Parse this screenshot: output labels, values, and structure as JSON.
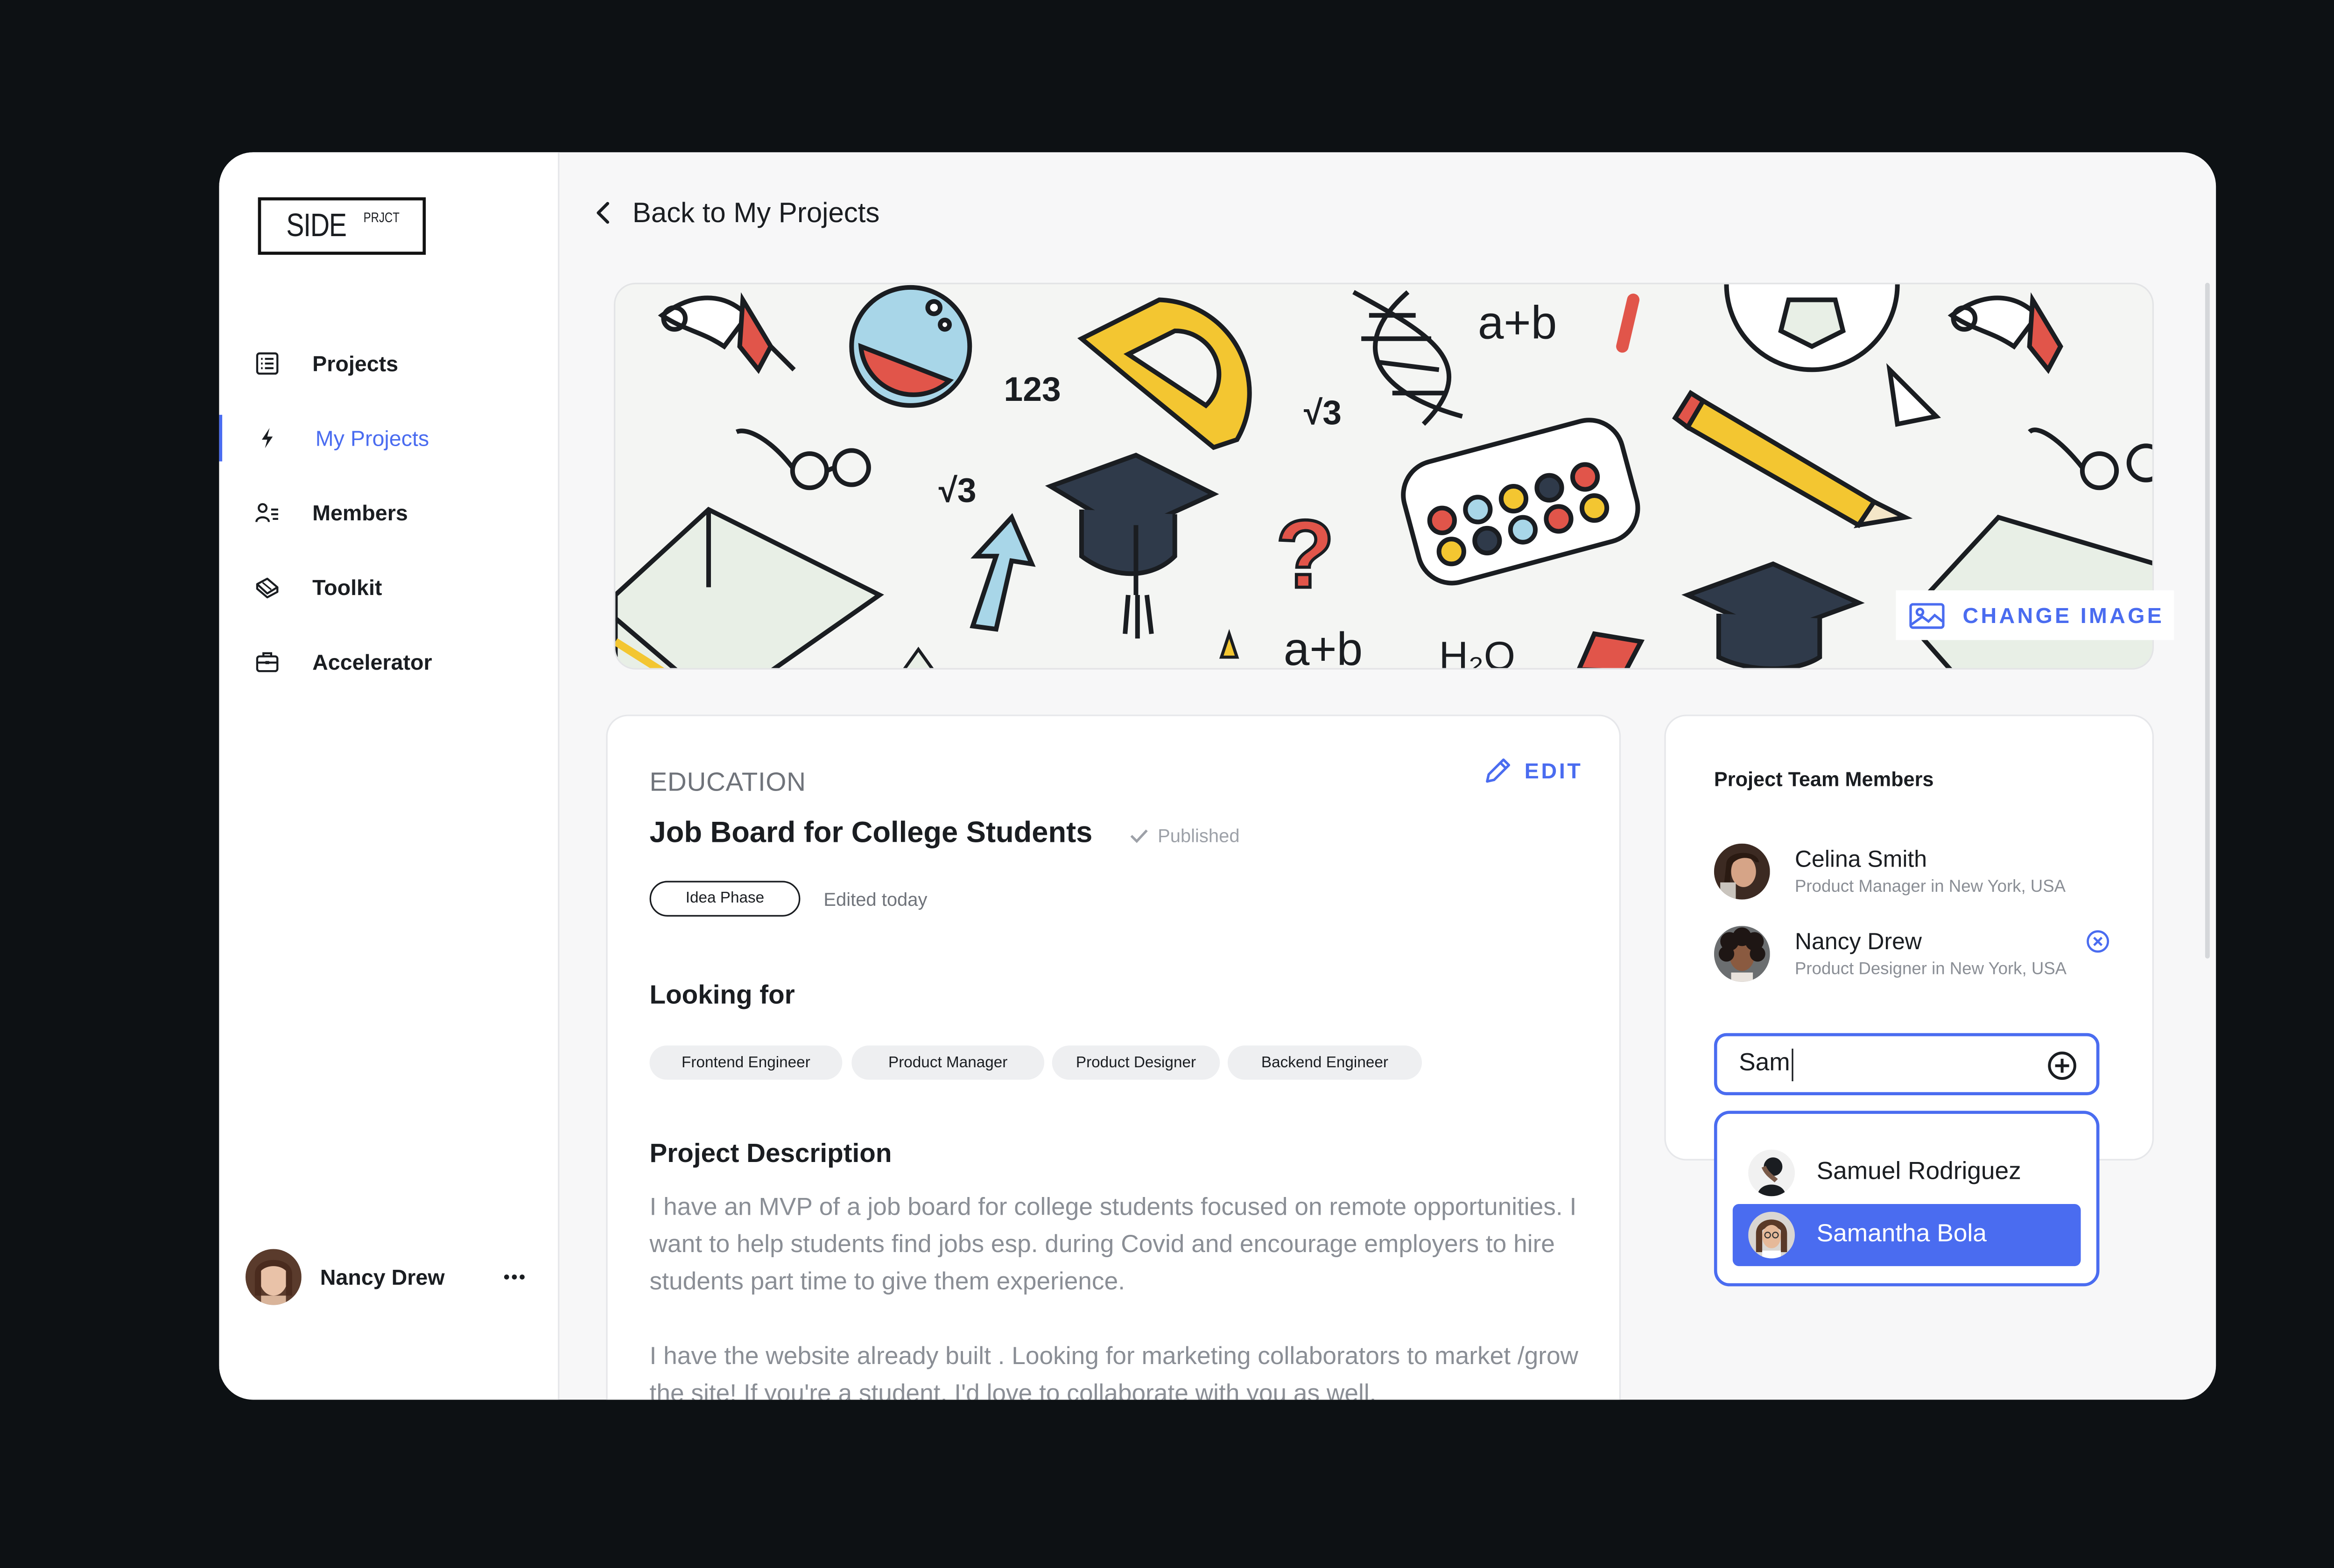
{
  "app": {
    "logo_main": "SIDE",
    "logo_sub": "PRJCT"
  },
  "sidebar": {
    "items": [
      {
        "label": "Projects",
        "icon": "list-icon",
        "active": false
      },
      {
        "label": "My Projects",
        "icon": "lightning-icon",
        "active": true
      },
      {
        "label": "Members",
        "icon": "members-icon",
        "active": false
      },
      {
        "label": "Toolkit",
        "icon": "toolkit-icon",
        "active": false
      },
      {
        "label": "Accelerator",
        "icon": "briefcase-icon",
        "active": false
      }
    ],
    "user": {
      "name": "Nancy Drew",
      "more_icon": "ellipsis-icon"
    }
  },
  "header": {
    "back_label": "Back to My Projects",
    "back_icon": "chevron-left-icon"
  },
  "banner": {
    "change_image_label": "CHANGE IMAGE",
    "change_image_icon": "image-icon",
    "texts": [
      "a+b",
      "123",
      "√3",
      "√3",
      "a+b",
      "H₂O",
      "?"
    ]
  },
  "project": {
    "category": "EDUCATION",
    "title": "Job Board for College Students",
    "status": "Published",
    "phase": "Idea Phase",
    "edited": "Edited today",
    "edit_label": "EDIT",
    "looking_for_heading": "Looking for",
    "roles": [
      "Frontend Engineer",
      "Product Manager",
      "Product Designer",
      "Backend Engineer"
    ],
    "description_heading": "Project Description",
    "description_p1": "I have an MVP of a job board for college students focused on remote opportunities. I want to help students find jobs esp. during Covid and encourage employers to hire students part time to give them experience.",
    "description_p2": "I have the website already built . Looking for marketing collaborators to market /grow the site! If you're a student, I'd love to collaborate with you as well."
  },
  "team": {
    "title": "Project Team Members",
    "members": [
      {
        "name": "Celina Smith",
        "role": "Product Manager in New York, USA",
        "removable": false
      },
      {
        "name": "Nancy Drew",
        "role": "Product Designer in New York, USA",
        "removable": true
      }
    ],
    "search_value": "Sam",
    "suggestions": [
      {
        "name": "Samuel Rodriguez",
        "selected": false
      },
      {
        "name": "Samantha Bola",
        "selected": true
      }
    ]
  },
  "colors": {
    "accent": "#4a6cf0",
    "background": "#0d1114",
    "panel": "#f7f7f8",
    "chip": "#eeeff1"
  }
}
